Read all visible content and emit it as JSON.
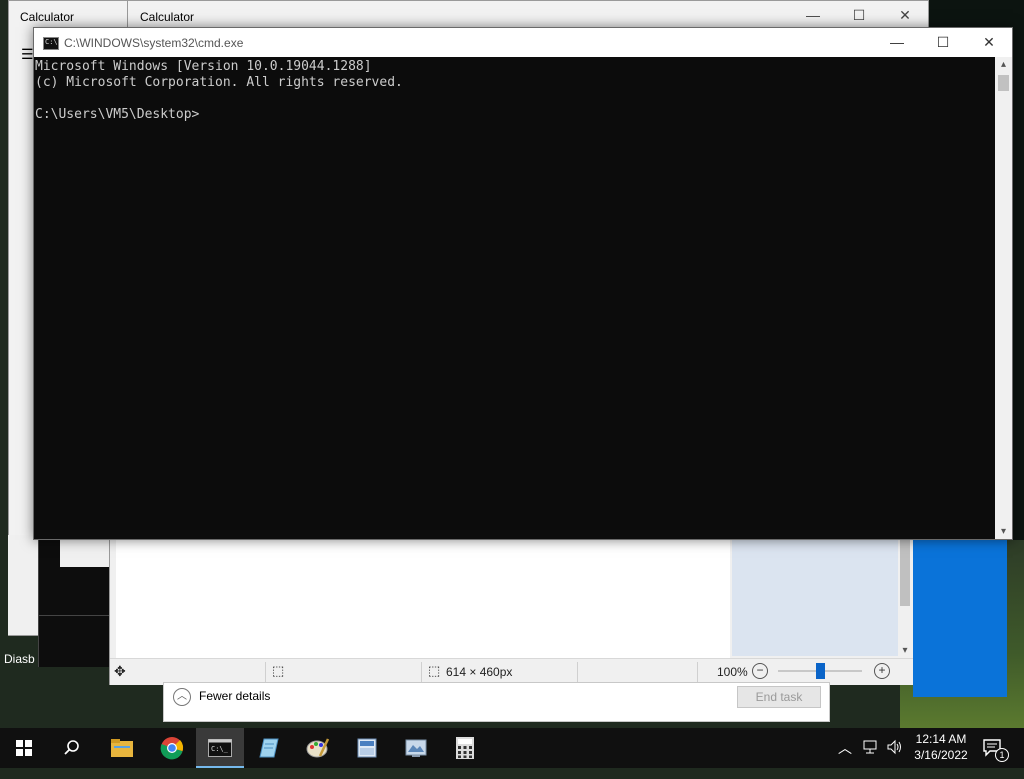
{
  "calculator_back": {
    "title": "Calculator",
    "menu_icon": "hamburger-menu-icon"
  },
  "calculator_front": {
    "title": "Calculator",
    "minimize": "—",
    "maximize": "☐",
    "close": "✕"
  },
  "left_snippet": {
    "text": "Diasb"
  },
  "cmd": {
    "title": "C:\\WINDOWS\\system32\\cmd.exe",
    "minimize": "—",
    "maximize": "☐",
    "close": "✕",
    "lines": [
      "Microsoft Windows [Version 10.0.19044.1288]",
      "(c) Microsoft Corporation. All rights reserved.",
      "",
      "C:\\Users\\VM5\\Desktop>"
    ]
  },
  "paint": {
    "status_size": "614 × 460px",
    "zoom": "100%",
    "zoom_level_percent": 100
  },
  "taskmgr": {
    "fewer_details": "Fewer details",
    "end_task": "End task"
  },
  "taskbar": {
    "items": [
      "start-icon",
      "search-icon",
      "file-explorer-icon",
      "chrome-icon",
      "cmd-icon",
      "notepad-icon",
      "paint-icon",
      "app-icon",
      "app2-icon",
      "calculator-icon"
    ],
    "time": "12:14 AM",
    "date": "3/16/2022",
    "notification_count": "1"
  }
}
